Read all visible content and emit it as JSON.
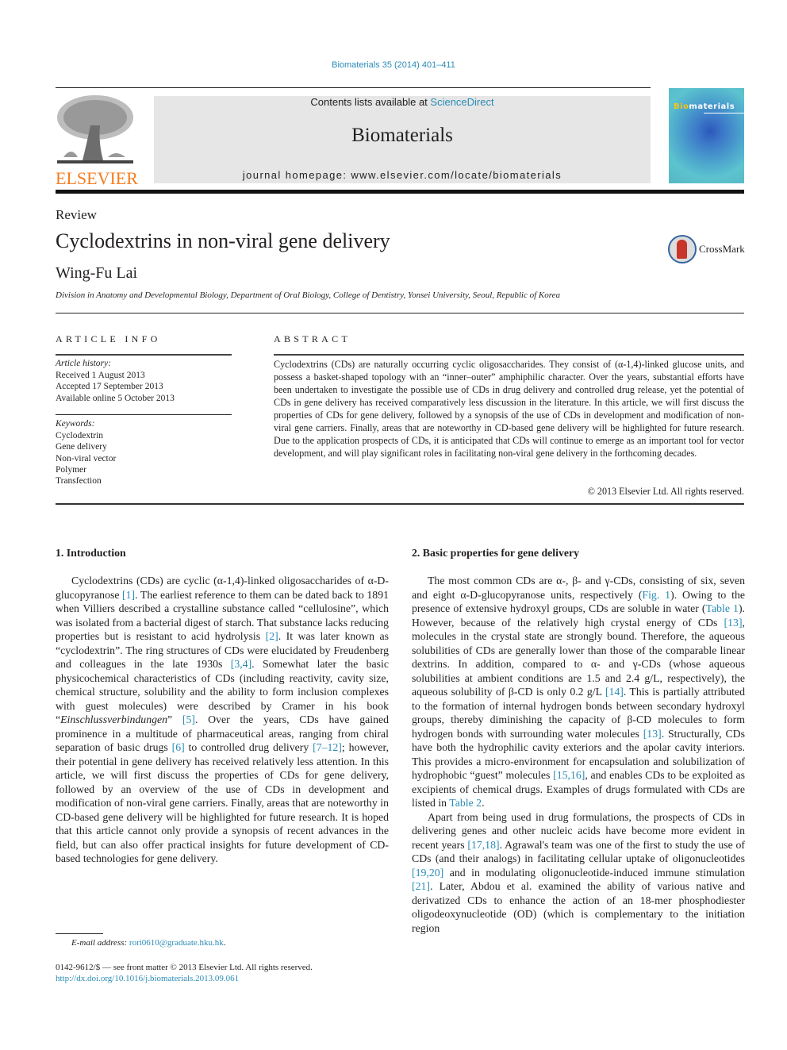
{
  "header": {
    "journal_ref": "Biomaterials 35 (2014) 401–411",
    "contents_prefix": "Contents lists available at ",
    "contents_link": "ScienceDirect",
    "journal_name": "Biomaterials",
    "homepage": "journal homepage: www.elsevier.com/locate/biomaterials",
    "publisher_logo": "ELSEVIER",
    "cover_title_a": "Bio",
    "cover_title_b": "materials",
    "colors": {
      "link": "#2a8bb5",
      "elsevier_orange": "#f47d20",
      "masthead_bg": "#e6e6e6"
    }
  },
  "article": {
    "type": "Review",
    "title": "Cyclodextrins in non-viral gene delivery",
    "crossmark_label": "CrossMark",
    "author": "Wing-Fu Lai",
    "affiliation": "Division in Anatomy and Developmental Biology, Department of Oral Biology, College of Dentistry, Yonsei University, Seoul, Republic of Korea"
  },
  "article_info": {
    "heading": "ARTICLE INFO",
    "history_label": "Article history:",
    "history": [
      "Received 1 August 2013",
      "Accepted 17 September 2013",
      "Available online 5 October 2013"
    ],
    "keywords_label": "Keywords:",
    "keywords": [
      "Cyclodextrin",
      "Gene delivery",
      "Non-viral vector",
      "Polymer",
      "Transfection"
    ]
  },
  "abstract": {
    "heading": "ABSTRACT",
    "text": "Cyclodextrins (CDs) are naturally occurring cyclic oligosaccharides. They consist of (α-1,4)-linked glucose units, and possess a basket-shaped topology with an “inner–outer” amphiphilic character. Over the years, substantial efforts have been undertaken to investigate the possible use of CDs in drug delivery and controlled drug release, yet the potential of CDs in gene delivery has received comparatively less discussion in the literature. In this article, we will first discuss the properties of CDs for gene delivery, followed by a synopsis of the use of CDs in development and modification of non-viral gene carriers. Finally, areas that are noteworthy in CD-based gene delivery will be highlighted for future research. Due to the application prospects of CDs, it is anticipated that CDs will continue to emerge as an important tool for vector development, and will play significant roles in facilitating non-viral gene delivery in the forthcoming decades.",
    "copyright": "© 2013 Elsevier Ltd. All rights reserved."
  },
  "section1": {
    "heading": "1.  Introduction",
    "segments": [
      {
        "t": "Cyclodextrins (CDs) are cyclic (α-1,4)-linked oligosaccharides of α-D-glucopyranose "
      },
      {
        "ref": "[1]"
      },
      {
        "t": ". The earliest reference to them can be dated back to 1891 when Villiers described a crystalline substance called “cellulosine”, which was isolated from a bacterial digest of starch. That substance lacks reducing properties but is resistant to acid hydrolysis "
      },
      {
        "ref": "[2]"
      },
      {
        "t": ". It was later known as “cyclodextrin”. The ring structures of CDs were elucidated by Freudenberg and colleagues in the late 1930s "
      },
      {
        "ref": "[3,4]"
      },
      {
        "t": ". Somewhat later the basic physicochemical characteristics of CDs (including reactivity, cavity size, chemical structure, solubility and the ability to form inclusion complexes with guest molecules) were described by Cramer in his book “"
      },
      {
        "i": "Einschlussverbindungen"
      },
      {
        "t": "” "
      },
      {
        "ref": "[5]"
      },
      {
        "t": ". Over the years, CDs have gained prominence in a multitude of pharmaceutical areas, ranging from chiral separation of basic drugs "
      },
      {
        "ref": "[6]"
      },
      {
        "t": " to controlled drug delivery "
      },
      {
        "ref": "[7–12]"
      },
      {
        "t": "; however, their potential in gene delivery has received relatively less attention. In this article, we will first discuss the properties of CDs for gene delivery, followed by an overview of the use of CDs in development and modification of non-viral gene carriers. Finally, areas that are noteworthy in CD-based gene delivery will be highlighted for future research. It is hoped that this article cannot only provide a synopsis of recent advances in the field, but can also offer practical insights for future development of CD-based technologies for gene delivery."
      }
    ]
  },
  "section2": {
    "heading": "2.  Basic properties for gene delivery",
    "para1": [
      {
        "t": "The most common CDs are α-, β- and γ-CDs, consisting of six, seven and eight α-D-glucopyranose units, respectively ("
      },
      {
        "ref": "Fig. 1"
      },
      {
        "t": "). Owing to the presence of extensive hydroxyl groups, CDs are soluble in water ("
      },
      {
        "ref": "Table 1"
      },
      {
        "t": "). However, because of the relatively high crystal energy of CDs "
      },
      {
        "ref": "[13]"
      },
      {
        "t": ", molecules in the crystal state are strongly bound. Therefore, the aqueous solubilities of CDs are generally lower than those of the comparable linear dextrins. In addition, compared to α- and γ-CDs (whose aqueous solubilities at ambient conditions are 1.5 and 2.4 g/L, respectively), the aqueous solubility of β-CD is only 0.2 g/L "
      },
      {
        "ref": "[14]"
      },
      {
        "t": ". This is partially attributed to the formation of internal hydrogen bonds between secondary hydroxyl groups, thereby diminishing the capacity of β-CD molecules to form hydrogen bonds with surrounding water molecules "
      },
      {
        "ref": "[13]"
      },
      {
        "t": ". Structurally, CDs have both the hydrophilic cavity exteriors and the apolar cavity interiors. This provides a micro-environment for encapsulation and solubilization of hydrophobic “guest” molecules "
      },
      {
        "ref": "[15,16]"
      },
      {
        "t": ", and enables CDs to be exploited as excipients of chemical drugs. Examples of drugs formulated with CDs are listed in "
      },
      {
        "ref": "Table 2"
      },
      {
        "t": "."
      }
    ],
    "para2": [
      {
        "t": "Apart from being used in drug formulations, the prospects of CDs in delivering genes and other nucleic acids have become more evident in recent years "
      },
      {
        "ref": "[17,18]"
      },
      {
        "t": ". Agrawal's team was one of the first to study the use of CDs (and their analogs) in facilitating cellular uptake of oligonucleotides "
      },
      {
        "ref": "[19,20]"
      },
      {
        "t": " and in modulating oligonucleotide-induced immune stimulation "
      },
      {
        "ref": "[21]"
      },
      {
        "t": ". Later, Abdou et al. examined the ability of various native and derivatized CDs to enhance the action of an 18-mer phosphodiester oligodeoxynucleotide (OD) (which is complementary to the initiation region"
      }
    ]
  },
  "footer": {
    "email_label": "E-mail address:",
    "email": "rori0610@graduate.hku.hk",
    "email_suffix": ".",
    "issn_line": "0142-9612/$ — see front matter © 2013 Elsevier Ltd. All rights reserved.",
    "doi": "http://dx.doi.org/10.1016/j.biomaterials.2013.09.061"
  }
}
